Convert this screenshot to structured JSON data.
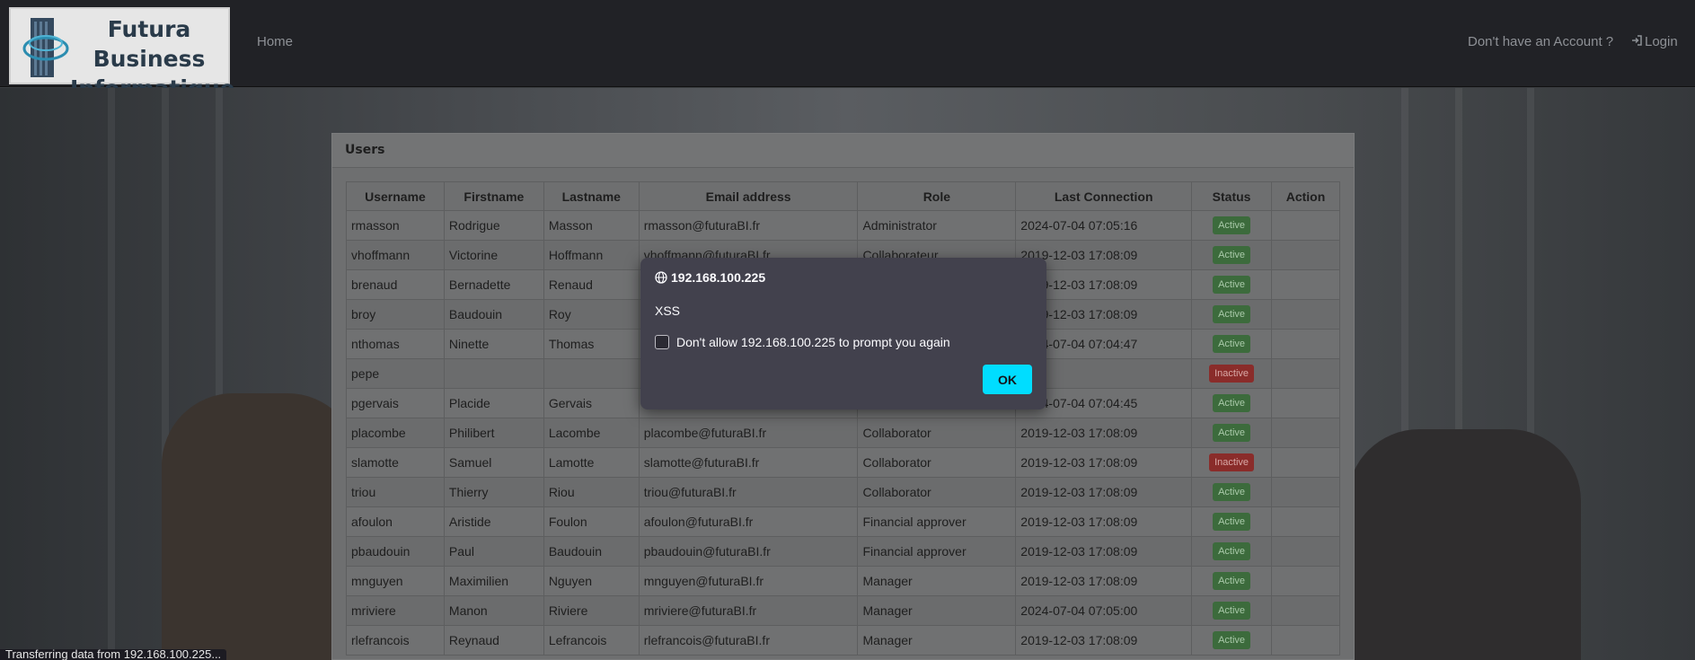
{
  "header": {
    "logo_line1": "Futura Business",
    "logo_line2": "Informatique",
    "nav_home": "Home",
    "nav_account": "Don't have an Account ?",
    "nav_login": "Login"
  },
  "panel": {
    "title": "Users"
  },
  "table": {
    "columns": [
      "Username",
      "Firstname",
      "Lastname",
      "Email address",
      "Role",
      "Last Connection",
      "Status",
      "Action"
    ],
    "rows": [
      {
        "username": "rmasson",
        "firstname": "Rodrigue",
        "lastname": "Masson",
        "email": "rmasson@futuraBI.fr",
        "role": "Administrator",
        "last": "2024-07-04 07:05:16",
        "status": "Active"
      },
      {
        "username": "vhoffmann",
        "firstname": "Victorine",
        "lastname": "Hoffmann",
        "email": "vhoffmann@futuraBI.fr",
        "role": "Collaborateur",
        "last": "2019-12-03 17:08:09",
        "status": "Active"
      },
      {
        "username": "brenaud",
        "firstname": "Bernadette",
        "lastname": "Renaud",
        "email": "",
        "role": "",
        "last": "2019-12-03 17:08:09",
        "status": "Active"
      },
      {
        "username": "broy",
        "firstname": "Baudouin",
        "lastname": "Roy",
        "email": "",
        "role": "",
        "last": "2019-12-03 17:08:09",
        "status": "Active"
      },
      {
        "username": "nthomas",
        "firstname": "Ninette",
        "lastname": "Thomas",
        "email": "",
        "role": "",
        "last": "2024-07-04 07:04:47",
        "status": "Active"
      },
      {
        "username": "pepe",
        "firstname": "",
        "lastname": "",
        "email": "",
        "role": "",
        "last": "",
        "status": "Inactive"
      },
      {
        "username": "pgervais",
        "firstname": "Placide",
        "lastname": "Gervais",
        "email": "",
        "role": "",
        "last": "2024-07-04 07:04:45",
        "status": "Active"
      },
      {
        "username": "placombe",
        "firstname": "Philibert",
        "lastname": "Lacombe",
        "email": "placombe@futuraBI.fr",
        "role": "Collaborator",
        "last": "2019-12-03 17:08:09",
        "status": "Active"
      },
      {
        "username": "slamotte",
        "firstname": "Samuel",
        "lastname": "Lamotte",
        "email": "slamotte@futuraBI.fr",
        "role": "Collaborator",
        "last": "2019-12-03 17:08:09",
        "status": "Inactive"
      },
      {
        "username": "triou",
        "firstname": "Thierry",
        "lastname": "Riou",
        "email": "triou@futuraBI.fr",
        "role": "Collaborator",
        "last": "2019-12-03 17:08:09",
        "status": "Active"
      },
      {
        "username": "afoulon",
        "firstname": "Aristide",
        "lastname": "Foulon",
        "email": "afoulon@futuraBI.fr",
        "role": "Financial approver",
        "last": "2019-12-03 17:08:09",
        "status": "Active"
      },
      {
        "username": "pbaudouin",
        "firstname": "Paul",
        "lastname": "Baudouin",
        "email": "pbaudouin@futuraBI.fr",
        "role": "Financial approver",
        "last": "2019-12-03 17:08:09",
        "status": "Active"
      },
      {
        "username": "mnguyen",
        "firstname": "Maximilien",
        "lastname": "Nguyen",
        "email": "mnguyen@futuraBI.fr",
        "role": "Manager",
        "last": "2019-12-03 17:08:09",
        "status": "Active"
      },
      {
        "username": "mriviere",
        "firstname": "Manon",
        "lastname": "Riviere",
        "email": "mriviere@futuraBI.fr",
        "role": "Manager",
        "last": "2024-07-04 07:05:00",
        "status": "Active"
      },
      {
        "username": "rlefrancois",
        "firstname": "Reynaud",
        "lastname": "Lefrancois",
        "email": "rlefrancois@futuraBI.fr",
        "role": "Manager",
        "last": "2019-12-03 17:08:09",
        "status": "Active"
      }
    ]
  },
  "dialog": {
    "host": "192.168.100.225",
    "message": "XSS",
    "checkbox_label": "Don't allow 192.168.100.225 to prompt you again",
    "ok_label": "OK"
  },
  "statusbar": {
    "text": "Transferring data from 192.168.100.225..."
  },
  "colors": {
    "active_badge": "#3c6b3c",
    "inactive_badge": "#8a2c2a",
    "ok_button": "#00ddff",
    "dialog_bg": "#42414d"
  }
}
